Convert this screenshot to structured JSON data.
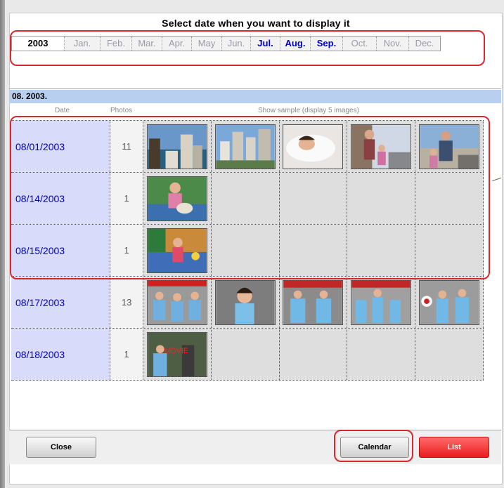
{
  "dialog": {
    "title": "Select date when you want to display it"
  },
  "month_bar": {
    "year": "2003",
    "months": [
      {
        "label": "Jan.",
        "active": false
      },
      {
        "label": "Feb.",
        "active": false
      },
      {
        "label": "Mar.",
        "active": false
      },
      {
        "label": "Apr.",
        "active": false
      },
      {
        "label": "May",
        "active": false
      },
      {
        "label": "Jun.",
        "active": false
      },
      {
        "label": "Jul.",
        "active": true
      },
      {
        "label": "Aug.",
        "active": true
      },
      {
        "label": "Sep.",
        "active": true
      },
      {
        "label": "Oct.",
        "active": false
      },
      {
        "label": "Nov.",
        "active": false
      },
      {
        "label": "Dec.",
        "active": false
      }
    ]
  },
  "section": {
    "header": "08. 2003.",
    "col_date": "Date",
    "col_photos": "Photos",
    "col_sample": "Show sample (display 5 images)"
  },
  "rows": [
    {
      "date": "08/01/2003",
      "photos": "11",
      "samples": 5
    },
    {
      "date": "08/14/2003",
      "photos": "1",
      "samples": 1
    },
    {
      "date": "08/15/2003",
      "photos": "1",
      "samples": 1
    },
    {
      "date": "08/17/2003",
      "photos": "13",
      "samples": 5
    },
    {
      "date": "08/18/2003",
      "photos": "1",
      "samples": 1
    }
  ],
  "thumbnail_overlay": "MOVIE",
  "buttons": {
    "close": "Close",
    "calendar": "Calendar",
    "list": "List"
  },
  "colors": {
    "accent_blue": "#0000cc",
    "highlight_red": "#d8272f",
    "section_bg": "#b9cff0",
    "date_bg": "#d9dbfa"
  }
}
